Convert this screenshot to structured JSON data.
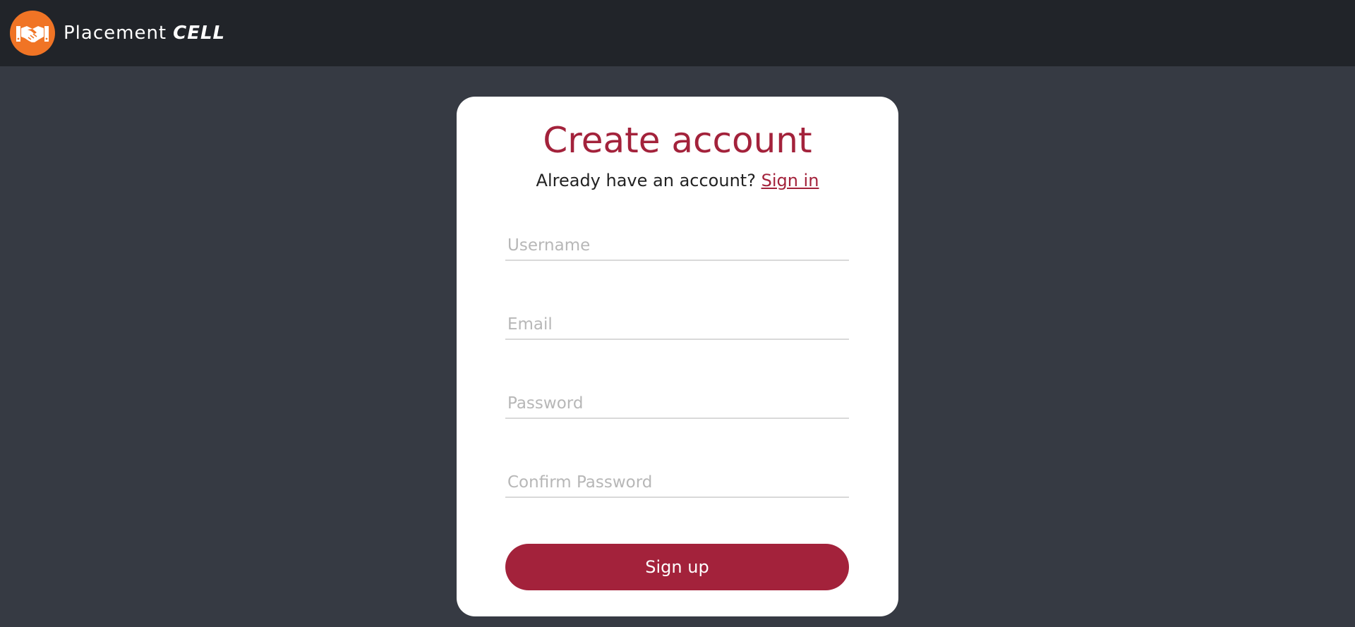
{
  "navbar": {
    "brand_name": "Placement",
    "brand_emphasis": "CELL",
    "logo_icon": "handshake-icon",
    "logo_color": "#f07425",
    "background": "#212429"
  },
  "form": {
    "title": "Create account",
    "subtitle_text": "Already have an account?",
    "signin_link": "Sign in",
    "username_placeholder": "Username",
    "username_value": "",
    "email_placeholder": "Email",
    "email_value": "",
    "password_placeholder": "Password",
    "password_value": "",
    "confirm_password_placeholder": "Confirm Password",
    "confirm_password_value": "",
    "submit_label": "Sign up",
    "accent_color": "#a3223b"
  },
  "page": {
    "background": "#363a43"
  }
}
